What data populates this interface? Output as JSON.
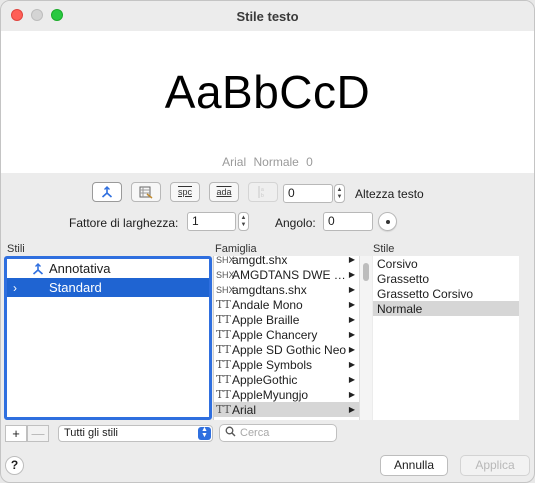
{
  "window": {
    "title": "Stile testo"
  },
  "preview": {
    "sample_text": "AaBbCcD",
    "info": "Arial  Normale  0"
  },
  "toolbar": {
    "buttons": [
      {
        "icon": "annotative-icon",
        "state": "active"
      },
      {
        "icon": "style-grid-icon",
        "state": "normal"
      },
      {
        "icon": "spc",
        "state": "normal"
      },
      {
        "icon": "ada",
        "state": "normal"
      },
      {
        "icon": "vertical-text-icon",
        "state": "disabled"
      }
    ],
    "spc_label": "spc",
    "ada_label": "ada",
    "height_value": "0",
    "height_label": "Altezza testo"
  },
  "width_factor": {
    "label": "Fattore di larghezza:",
    "value": "1"
  },
  "angle": {
    "label": "Angolo:",
    "value": "0"
  },
  "columns": {
    "styles": "Stili",
    "family": "Famiglia",
    "style": "Stile"
  },
  "styles_list": [
    {
      "label": "Annotativa",
      "selected": false
    },
    {
      "label": "Standard",
      "selected": true
    }
  ],
  "family_list": [
    {
      "label": "amgdt.shx",
      "icon": "SHX"
    },
    {
      "label": "AMGDTANS DWE E...",
      "icon": "SHX"
    },
    {
      "label": "amgdtans.shx",
      "icon": "SHX"
    },
    {
      "label": "Andale Mono",
      "icon": "TT"
    },
    {
      "label": "Apple Braille",
      "icon": "TT"
    },
    {
      "label": "Apple Chancery",
      "icon": "TT"
    },
    {
      "label": "Apple SD Gothic Neo",
      "icon": "TT"
    },
    {
      "label": "Apple Symbols",
      "icon": "TT"
    },
    {
      "label": "AppleGothic",
      "icon": "TT"
    },
    {
      "label": "AppleMyungjo",
      "icon": "TT"
    },
    {
      "label": "Arial",
      "icon": "TT",
      "selected": true
    }
  ],
  "style_list": [
    {
      "label": "Corsivo"
    },
    {
      "label": "Grassetto"
    },
    {
      "label": "Grassetto Corsivo"
    },
    {
      "label": "Normale",
      "selected": true
    }
  ],
  "bottom": {
    "add": "+",
    "remove": "—",
    "filter": "Tutti gli stili",
    "search_placeholder": "Cerca",
    "help": "?",
    "cancel": "Annulla",
    "apply": "Applica"
  },
  "colors": {
    "accent": "#1f64d2",
    "selection_gray": "#d6d6d6"
  }
}
